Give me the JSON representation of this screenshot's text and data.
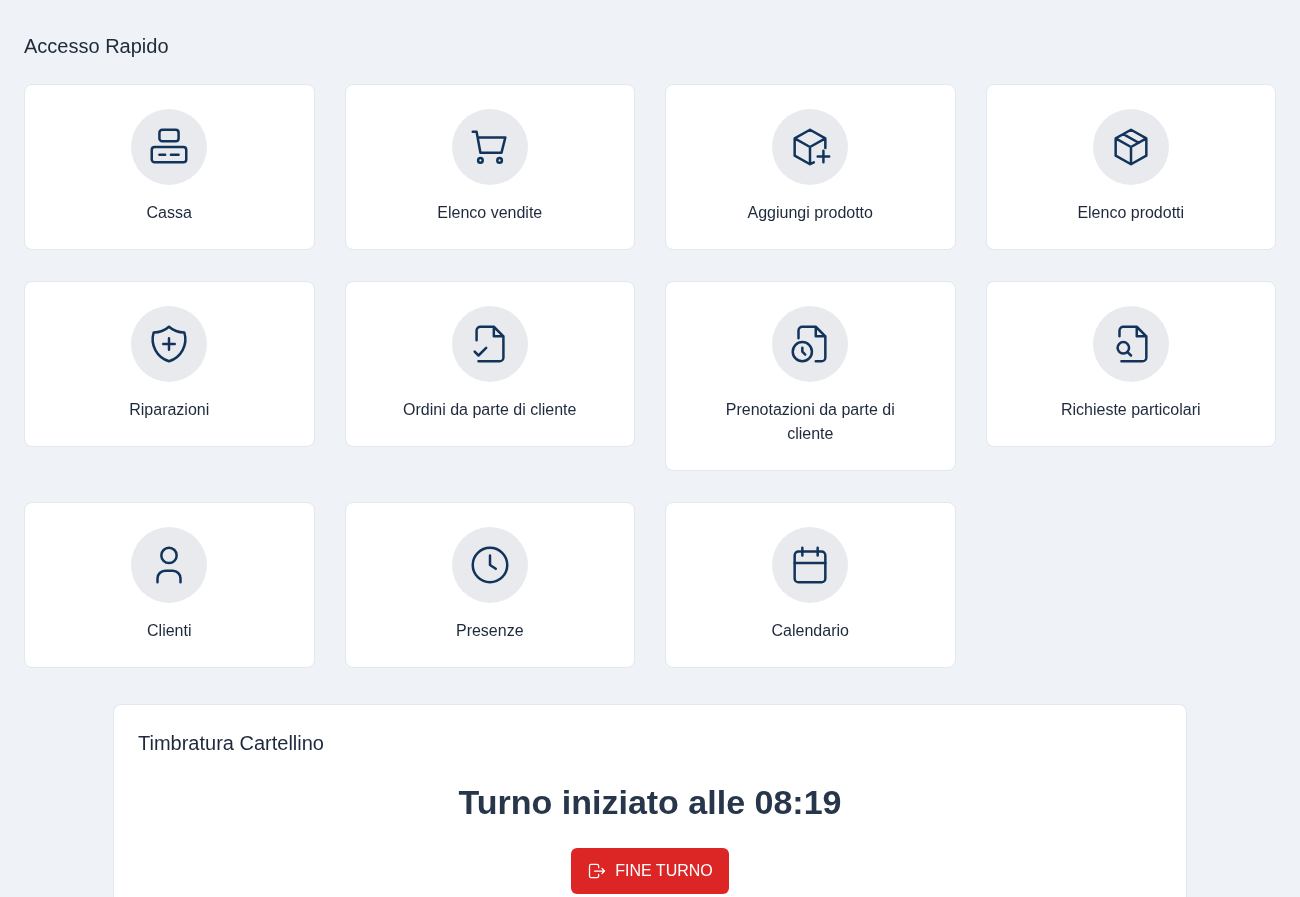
{
  "section_title": "Accesso Rapido",
  "tiles": [
    {
      "label": "Cassa",
      "kind": "register"
    },
    {
      "label": "Elenco vendite",
      "kind": "cart"
    },
    {
      "label": "Aggiungi prodotto",
      "kind": "boxplus"
    },
    {
      "label": "Elenco prodotti",
      "kind": "box"
    },
    {
      "label": "Riparazioni",
      "kind": "shield"
    },
    {
      "label": "Ordini da parte di cliente",
      "kind": "filecheck"
    },
    {
      "label": "Prenotazioni da parte di cliente",
      "kind": "fileclock"
    },
    {
      "label": "Richieste particolari",
      "kind": "filesearch"
    },
    {
      "label": "Clienti",
      "kind": "user"
    },
    {
      "label": "Presenze",
      "kind": "clock"
    },
    {
      "label": "Calendario",
      "kind": "calendar"
    }
  ],
  "timecard": {
    "title": "Timbratura Cartellino",
    "status": "Turno iniziato alle 08:19",
    "button": "FINE TURNO"
  }
}
